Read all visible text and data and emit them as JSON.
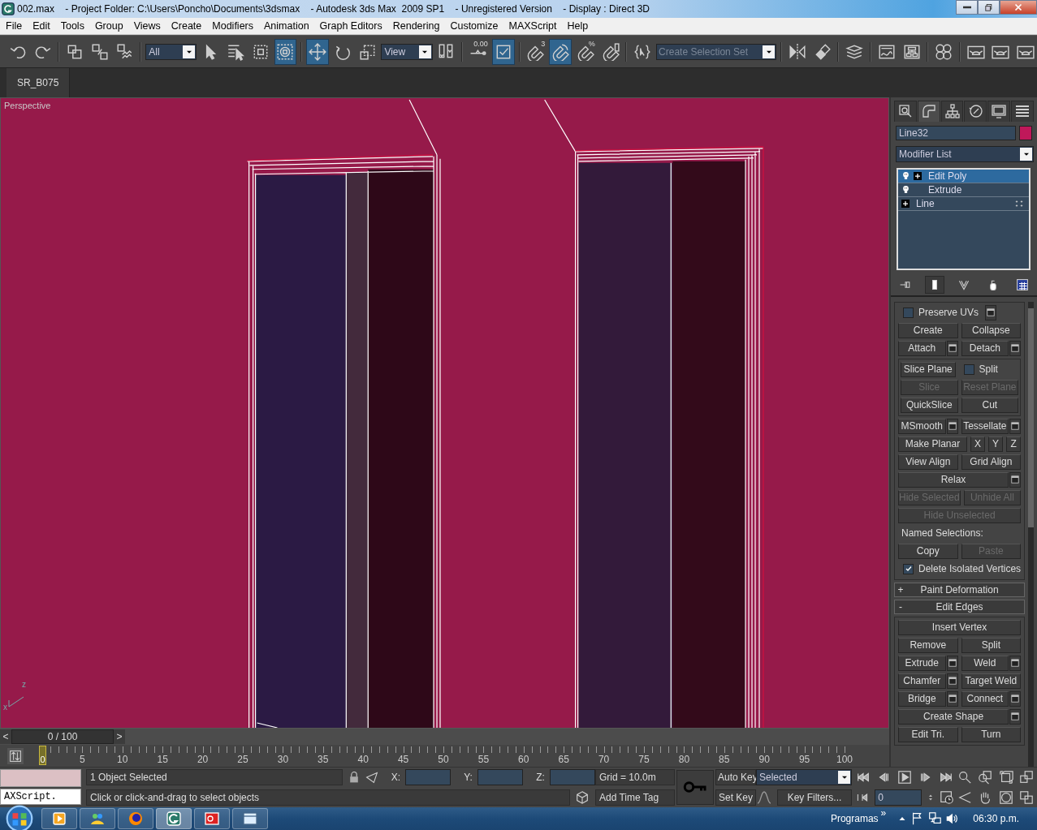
{
  "window": {
    "title": "002.max    - Project Folder: C:\\Users\\Poncho\\Documents\\3dsmax    - Autodesk 3ds Max  2009 SP1    - Unregistered Version    - Display : Direct 3D"
  },
  "menu": [
    "File",
    "Edit",
    "Tools",
    "Group",
    "Views",
    "Create",
    "Modifiers",
    "Animation",
    "Graph Editors",
    "Rendering",
    "Customize",
    "MAXScript",
    "Help"
  ],
  "main_toolbar": [
    {
      "kind": "button",
      "selected": false
    },
    {
      "kind": "button",
      "selected": false
    },
    {
      "kind": "separator"
    },
    {
      "kind": "button",
      "selected": false
    },
    {
      "kind": "button",
      "selected": false
    },
    {
      "kind": "button",
      "selected": false
    },
    {
      "kind": "separator"
    },
    {
      "kind": "dropdown",
      "value": "All"
    },
    {
      "kind": "button",
      "selected": false
    },
    {
      "kind": "button",
      "selected": false
    },
    {
      "kind": "button",
      "selected": false
    },
    {
      "kind": "button",
      "selected": true
    },
    {
      "kind": "separator"
    },
    {
      "kind": "button",
      "selected": true
    },
    {
      "kind": "button",
      "selected": false
    },
    {
      "kind": "button",
      "selected": false
    },
    {
      "kind": "dropdown",
      "value": "View"
    },
    {
      "kind": "button",
      "selected": false
    },
    {
      "kind": "separator"
    },
    {
      "kind": "button",
      "selected": false,
      "badge": "0.00"
    },
    {
      "kind": "button",
      "selected": true
    },
    {
      "kind": "separator"
    },
    {
      "kind": "button",
      "selected": false,
      "badge": "3"
    },
    {
      "kind": "button",
      "selected": true
    },
    {
      "kind": "button",
      "selected": false,
      "badge": "%"
    },
    {
      "kind": "button",
      "selected": false
    },
    {
      "kind": "separator"
    },
    {
      "kind": "button",
      "selected": false
    },
    {
      "kind": "combo",
      "placeholder": "Create Selection Set"
    },
    {
      "kind": "separator"
    },
    {
      "kind": "button",
      "selected": false
    },
    {
      "kind": "button",
      "selected": false
    },
    {
      "kind": "separator"
    },
    {
      "kind": "button",
      "selected": false
    },
    {
      "kind": "separator"
    },
    {
      "kind": "button",
      "selected": false
    },
    {
      "kind": "button",
      "selected": false
    },
    {
      "kind": "separator"
    },
    {
      "kind": "button",
      "selected": false
    },
    {
      "kind": "separator"
    },
    {
      "kind": "button",
      "selected": false
    },
    {
      "kind": "button",
      "selected": false
    },
    {
      "kind": "button",
      "selected": false
    }
  ],
  "toolbar_tabs": [
    {
      "label": "SR_B075"
    }
  ],
  "viewport": {
    "label": "Perspective",
    "axes": [
      "z",
      "x"
    ]
  },
  "command_panel": {
    "tabs": [
      {
        "selected": false
      },
      {
        "selected": true
      },
      {
        "selected": false
      },
      {
        "selected": false
      },
      {
        "selected": false
      },
      {
        "selected": false
      }
    ],
    "object_name": "Line32",
    "modifier_list": "Modifier List",
    "stack": [
      {
        "kind": "modifier",
        "name": "Edit Poly",
        "selected": true,
        "expandable": true,
        "on": true
      },
      {
        "kind": "modifier",
        "name": "Extrude",
        "selected": false,
        "expandable": false,
        "on": true
      },
      {
        "kind": "base",
        "name": "Line",
        "selected": false,
        "expandable": true
      }
    ],
    "stack_toolbar": [
      {
        "selected": false
      },
      {
        "selected": true
      },
      {
        "selected": false
      },
      {
        "selected": false
      },
      {
        "selected": false
      }
    ],
    "rollouts": [
      {
        "rows": [
          {
            "items": [
              {
                "kind": "checkbox",
                "label": "Preserve UVs",
                "checked": false,
                "settings": true
              }
            ]
          },
          {
            "items": [
              {
                "kind": "button",
                "label": "Create",
                "disabled": false
              },
              {
                "kind": "button",
                "label": "Collapse",
                "disabled": false
              }
            ]
          },
          {
            "items": [
              {
                "kind": "button",
                "label": "Attach",
                "disabled": false,
                "settings": true
              },
              {
                "kind": "button",
                "label": "Detach",
                "disabled": false,
                "settings": true
              }
            ]
          },
          {
            "kind": "group",
            "rows": [
              {
                "items": [
                  {
                    "kind": "button",
                    "label": "Slice Plane",
                    "disabled": false
                  },
                  {
                    "kind": "checkbox",
                    "label": "Split",
                    "checked": false
                  }
                ]
              },
              {
                "items": [
                  {
                    "kind": "button",
                    "label": "Slice",
                    "disabled": true
                  },
                  {
                    "kind": "button",
                    "label": "Reset Plane",
                    "disabled": true
                  }
                ]
              },
              {
                "items": [
                  {
                    "kind": "button",
                    "label": "QuickSlice",
                    "disabled": false
                  },
                  {
                    "kind": "button",
                    "label": "Cut",
                    "disabled": false
                  }
                ]
              }
            ]
          },
          {
            "items": [
              {
                "kind": "button",
                "label": "MSmooth",
                "disabled": false,
                "settings": true
              },
              {
                "kind": "button",
                "label": "Tessellate",
                "disabled": false,
                "settings": true
              }
            ]
          },
          {
            "items": [
              {
                "kind": "button",
                "label": "Make Planar",
                "disabled": false
              },
              {
                "kind": "axis_button",
                "label": "X",
                "disabled": false
              },
              {
                "kind": "axis_button",
                "label": "Y",
                "disabled": false
              },
              {
                "kind": "axis_button",
                "label": "Z",
                "disabled": false
              }
            ]
          },
          {
            "items": [
              {
                "kind": "button",
                "label": "View Align",
                "disabled": false
              },
              {
                "kind": "button",
                "label": "Grid Align",
                "disabled": false
              }
            ]
          },
          {
            "items": [
              {
                "kind": "button",
                "label": "Relax",
                "disabled": false,
                "settings": true
              }
            ]
          },
          {
            "items": [
              {
                "kind": "button",
                "label": "Hide Selected",
                "disabled": true
              },
              {
                "kind": "button",
                "label": "Unhide All",
                "disabled": true
              }
            ]
          },
          {
            "items": [
              {
                "kind": "button",
                "label": "Hide Unselected",
                "disabled": true
              }
            ]
          },
          {
            "items": [
              {
                "kind": "label",
                "label": "Named Selections:"
              }
            ]
          },
          {
            "items": [
              {
                "kind": "button",
                "label": "Copy",
                "disabled": false
              },
              {
                "kind": "button",
                "label": "Paste",
                "disabled": true
              }
            ]
          },
          {
            "items": [
              {
                "kind": "checkbox",
                "label": "Delete Isolated Vertices",
                "checked": true
              }
            ]
          }
        ]
      },
      {
        "sign": "+",
        "title": "Paint Deformation"
      },
      {
        "sign": "-",
        "title": "Edit Edges",
        "rows": [
          {
            "items": [
              {
                "kind": "button",
                "label": "Insert Vertex",
                "disabled": false
              }
            ]
          },
          {
            "items": [
              {
                "kind": "button",
                "label": "Remove",
                "disabled": false
              },
              {
                "kind": "button",
                "label": "Split",
                "disabled": false
              }
            ]
          },
          {
            "items": [
              {
                "kind": "button",
                "label": "Extrude",
                "disabled": false,
                "settings": true
              },
              {
                "kind": "button",
                "label": "Weld",
                "disabled": false,
                "settings": true
              }
            ]
          },
          {
            "items": [
              {
                "kind": "button",
                "label": "Chamfer",
                "disabled": false,
                "settings": true
              },
              {
                "kind": "button",
                "label": "Target Weld",
                "disabled": false
              }
            ]
          },
          {
            "items": [
              {
                "kind": "button",
                "label": "Bridge",
                "disabled": false,
                "settings": true
              },
              {
                "kind": "button",
                "label": "Connect",
                "disabled": false,
                "settings": true
              }
            ]
          },
          {
            "items": [
              {
                "kind": "button",
                "label": "Create Shape",
                "disabled": false,
                "settings": true
              }
            ]
          },
          {
            "items": [
              {
                "kind": "button",
                "label": "Edit Tri.",
                "disabled": false
              },
              {
                "kind": "button",
                "label": "Turn",
                "disabled": false
              }
            ]
          }
        ]
      }
    ]
  },
  "time_slider": {
    "prev": "<",
    "label": "0 / 100",
    "next": ">"
  },
  "trackbar": {
    "current": "0",
    "ticks": [
      "5",
      "10",
      "15",
      "20",
      "25",
      "30",
      "35",
      "40",
      "45",
      "50",
      "55",
      "60",
      "65",
      "70",
      "75",
      "80",
      "85",
      "90",
      "95",
      "100"
    ]
  },
  "status_bar": {
    "listener": "AXScript.",
    "selection": "1 Object Selected",
    "prompt": "Click or click-and-drag to select objects",
    "coords": [
      "X:",
      "Y:",
      "Z:"
    ],
    "grid": "Grid = 10.0m",
    "time_tag": "Add Time Tag"
  },
  "animation": {
    "auto_key": {
      "label": "Auto Key",
      "selected": false
    },
    "set_key": {
      "label": "Set Key",
      "selected": false
    },
    "key_mode": "Selected",
    "key_filters": "Key Filters...",
    "frame": "0"
  },
  "taskbar": {
    "tasks": [
      {
        "selected": false
      },
      {
        "selected": false
      },
      {
        "selected": false
      },
      {
        "selected": true
      },
      {
        "selected": false
      },
      {
        "selected": false
      }
    ],
    "toolbar_label": "Programas",
    "chevron": "»",
    "clock": "06:30 p.m."
  }
}
